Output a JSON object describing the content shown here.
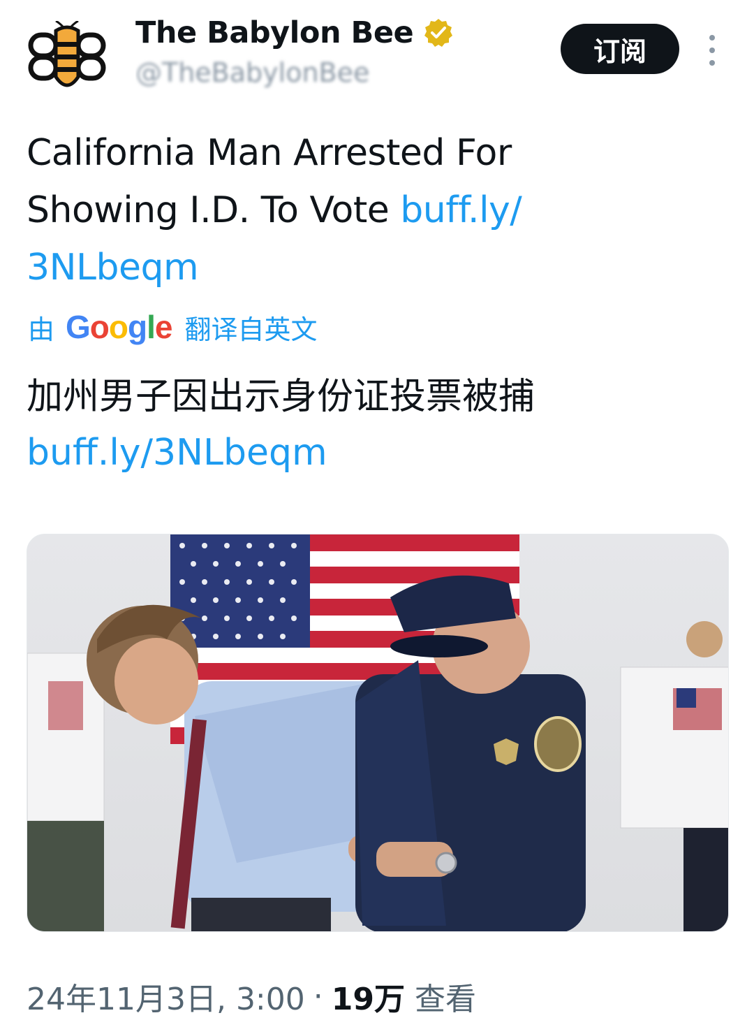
{
  "account": {
    "display_name": "The Babylon Bee",
    "handle": "@TheBabylonBee",
    "subscribe_label": "订阅"
  },
  "tweet": {
    "line1": "California Man Arrested For",
    "line2": "Showing I.D. To Vote ",
    "link_part1": "buff.ly/",
    "link_part2": "3NLbeqm"
  },
  "translation": {
    "prefix": "由",
    "google": [
      "G",
      "o",
      "o",
      "g",
      "l",
      "e"
    ],
    "suffix": "翻译自英文",
    "text": "加州男子因出示身份证投票被捕",
    "link": "buff.ly/3NLbeqm"
  },
  "meta": {
    "date": "24年11月3日, 3:00",
    "separator": "·",
    "views_count": "19万",
    "views_label": "查看"
  },
  "colors": {
    "link": "#1d9bf0",
    "verified_badge": "#e2b719",
    "button_bg": "#0f1419"
  },
  "icons": {
    "logo": "babylon-bee-logo",
    "verified": "verified-badge-icon",
    "more": "more-vertical-icon"
  }
}
